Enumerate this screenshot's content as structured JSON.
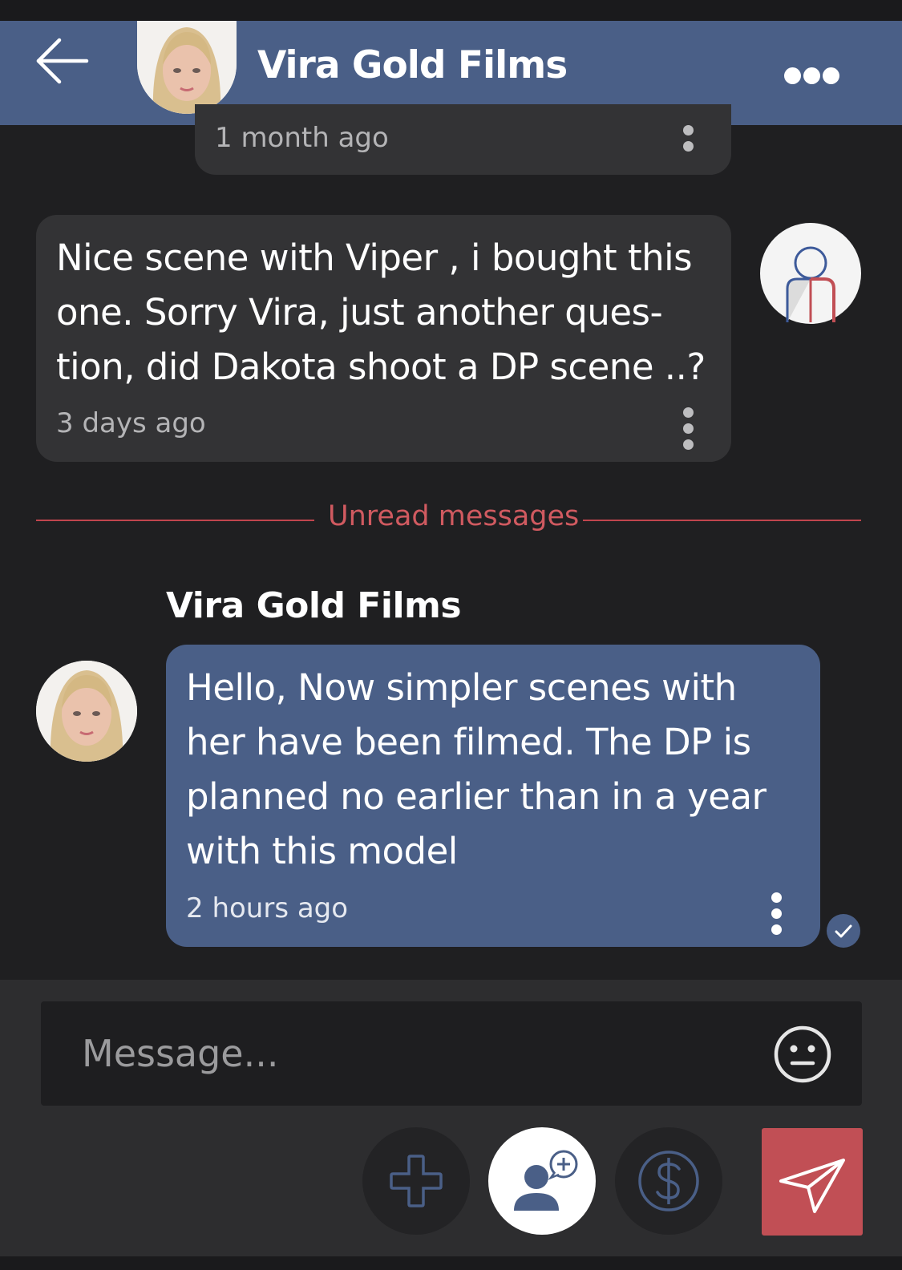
{
  "header": {
    "title": "Vira Gold Films",
    "back_icon": "arrow-left-icon",
    "more_icon": "more-dots-icon"
  },
  "messages": [
    {
      "timestamp": "1 month ago"
    },
    {
      "text": "Nice scene with Viper , i bought this one. Sorry Vira, just another ques-tion, did Dakota shoot a DP scene ..?",
      "lines": [
        "Nice scene with Viper , i bought this",
        "one. Sorry Vira, just another ques-",
        "tion, did Dakota shoot a DP scene ..?"
      ],
      "timestamp": "3 days ago"
    },
    {
      "sender": "Vira Gold Films",
      "text": "Hello, Now simpler scenes with her have been filmed. The DP is planned no earlier than in a year with this model",
      "lines": [
        "Hello, Now simpler scenes with",
        "her have been filmed. The DP is",
        "planned no earlier than in a year",
        "with this model"
      ],
      "timestamp": "2 hours ago"
    }
  ],
  "divider": {
    "label": "Unread messages"
  },
  "composer": {
    "placeholder": "Message...",
    "emoji_icon": "smiley-icon",
    "add_icon": "plus-icon",
    "contact_icon": "add-contact-icon",
    "tip_icon": "dollar-icon",
    "send_icon": "paper-plane-icon"
  },
  "colors": {
    "background": "#1f1f21",
    "header": "#4a5f87",
    "accent_red": "#c14f55",
    "bubble_dark": "#333335"
  }
}
